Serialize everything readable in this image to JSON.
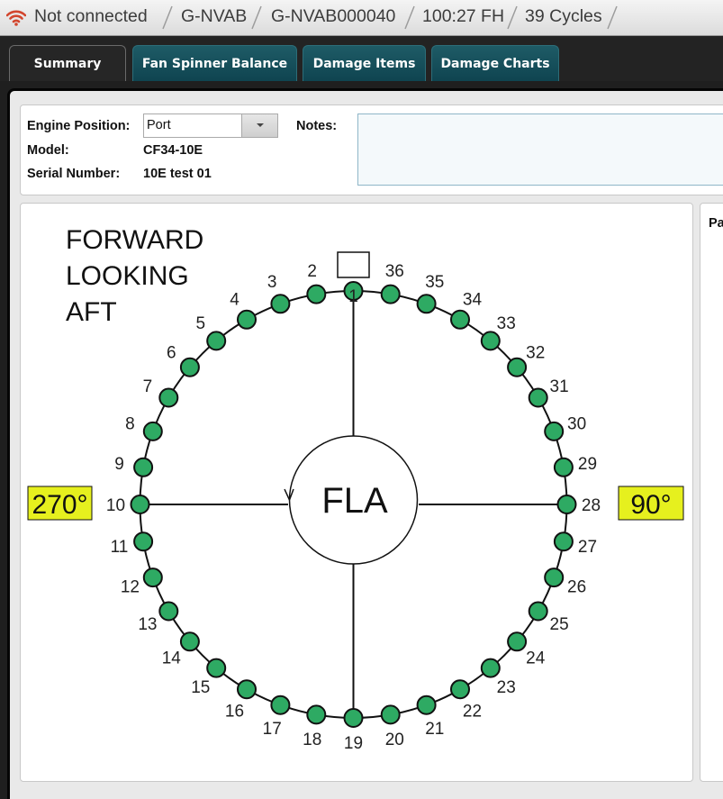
{
  "status": {
    "connection": "Not connected",
    "aircraft": "G-NVAB",
    "engine_id": "G-NVAB000040",
    "flight_hours": "100:27 FH",
    "cycles": "39 Cycles"
  },
  "tabs": [
    {
      "label": "Summary",
      "active": true
    },
    {
      "label": "Fan Spinner Balance",
      "active": false
    },
    {
      "label": "Damage Items",
      "active": false
    },
    {
      "label": "Damage Charts",
      "active": false
    }
  ],
  "info": {
    "engine_position_label": "Engine Position:",
    "engine_position_value": "Port",
    "notes_label": "Notes:",
    "notes_value": "",
    "model_label": "Model:",
    "model_value": "CF34-10E",
    "serial_label": "Serial Number:",
    "serial_value": "10E test 01"
  },
  "side_panel_label": "Pa",
  "diagram": {
    "header_lines": [
      "FORWARD",
      "LOOKING",
      "AFT"
    ],
    "left_degree": "270°",
    "right_degree": "90°",
    "center_label": "FLA",
    "blade_count": 36,
    "blade_labels": [
      "1",
      "2",
      "3",
      "4",
      "5",
      "6",
      "7",
      "8",
      "9",
      "10",
      "11",
      "12",
      "13",
      "14",
      "15",
      "16",
      "17",
      "18",
      "19",
      "20",
      "21",
      "22",
      "23",
      "24",
      "25",
      "26",
      "27",
      "28",
      "29",
      "30",
      "31",
      "32",
      "33",
      "34",
      "35",
      "36"
    ],
    "blade_status_color": "#2eaa63",
    "degree_badge_color": "#e6f01e"
  }
}
